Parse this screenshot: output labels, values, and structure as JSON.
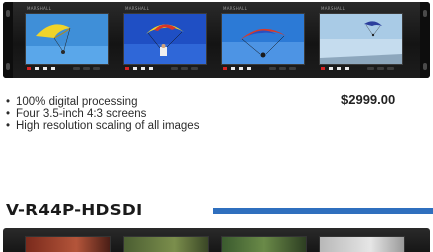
{
  "rack_unit": {
    "monitor_brand": "MARSHALL",
    "monitors": [
      {
        "scene": "parachute-yellow"
      },
      {
        "scene": "parachute-red-yellow"
      },
      {
        "scene": "parachute-red-blue"
      },
      {
        "scene": "parachute-sky"
      }
    ]
  },
  "product": {
    "price": "$2999.00",
    "features": [
      "100% digital processing",
      "Four 3.5-inch 4:3 screens",
      "High resolution scaling of all images"
    ]
  },
  "next_product": {
    "model": "V-R44P-HDSDI"
  },
  "colors": {
    "accent_bar": "#2f6fbe",
    "rack": "#1a1a1a"
  }
}
